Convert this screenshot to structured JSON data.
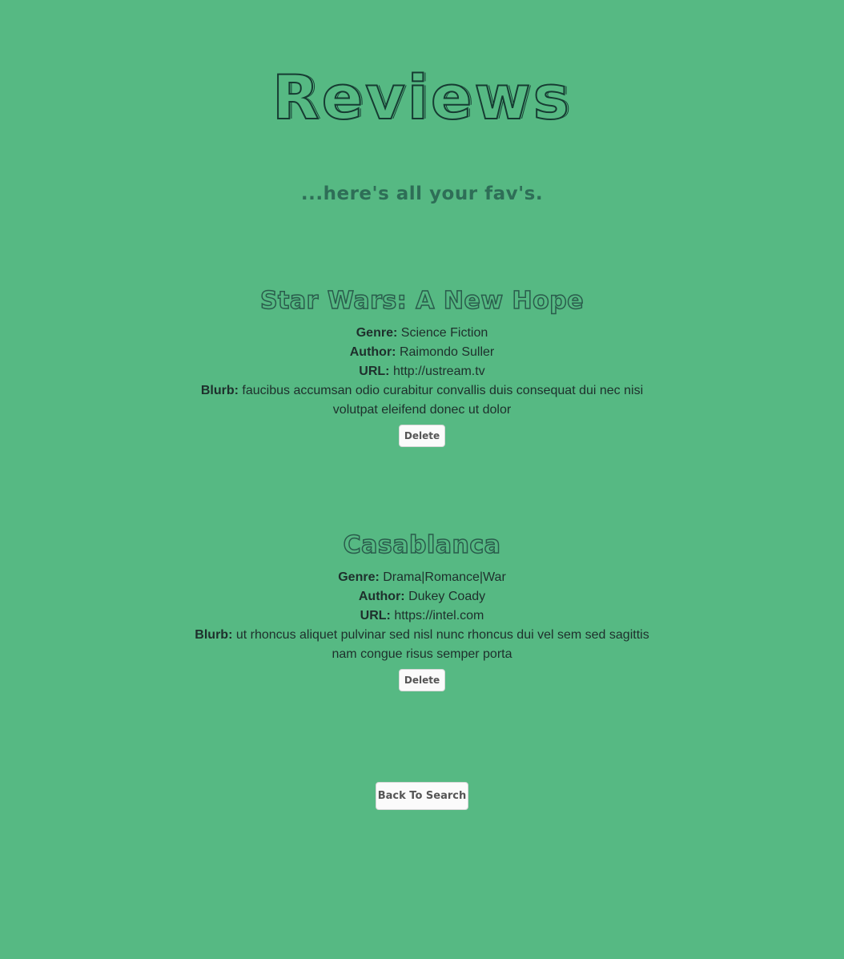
{
  "header": {
    "title": "Reviews",
    "subtitle": "...here's all your fav's."
  },
  "reviews": [
    {
      "title": "Star Wars: A New Hope",
      "genre_label": "Genre:",
      "genre": "Science Fiction",
      "author_label": "Author:",
      "author": "Raimondo Suller",
      "url_label": "URL:",
      "url": "http://ustream.tv",
      "blurb_label": "Blurb:",
      "blurb": "faucibus accumsan odio curabitur convallis duis consequat dui nec nisi volutpat eleifend donec ut dolor",
      "delete_label": "Delete"
    },
    {
      "title": "Casablanca",
      "genre_label": "Genre:",
      "genre": "Drama|Romance|War",
      "author_label": "Author:",
      "author": "Dukey Coady",
      "url_label": "URL:",
      "url": "https://intel.com",
      "blurb_label": "Blurb:",
      "blurb": "ut rhoncus aliquet pulvinar sed nisl nunc rhoncus dui vel sem sed sagittis nam congue risus semper porta",
      "delete_label": "Delete"
    }
  ],
  "footer": {
    "back_label": "Back To Search"
  },
  "colors": {
    "background": "#56b983",
    "title_stroke": "#163b32",
    "text": "#1e2f2c",
    "button_bg": "#fbfbfb"
  }
}
